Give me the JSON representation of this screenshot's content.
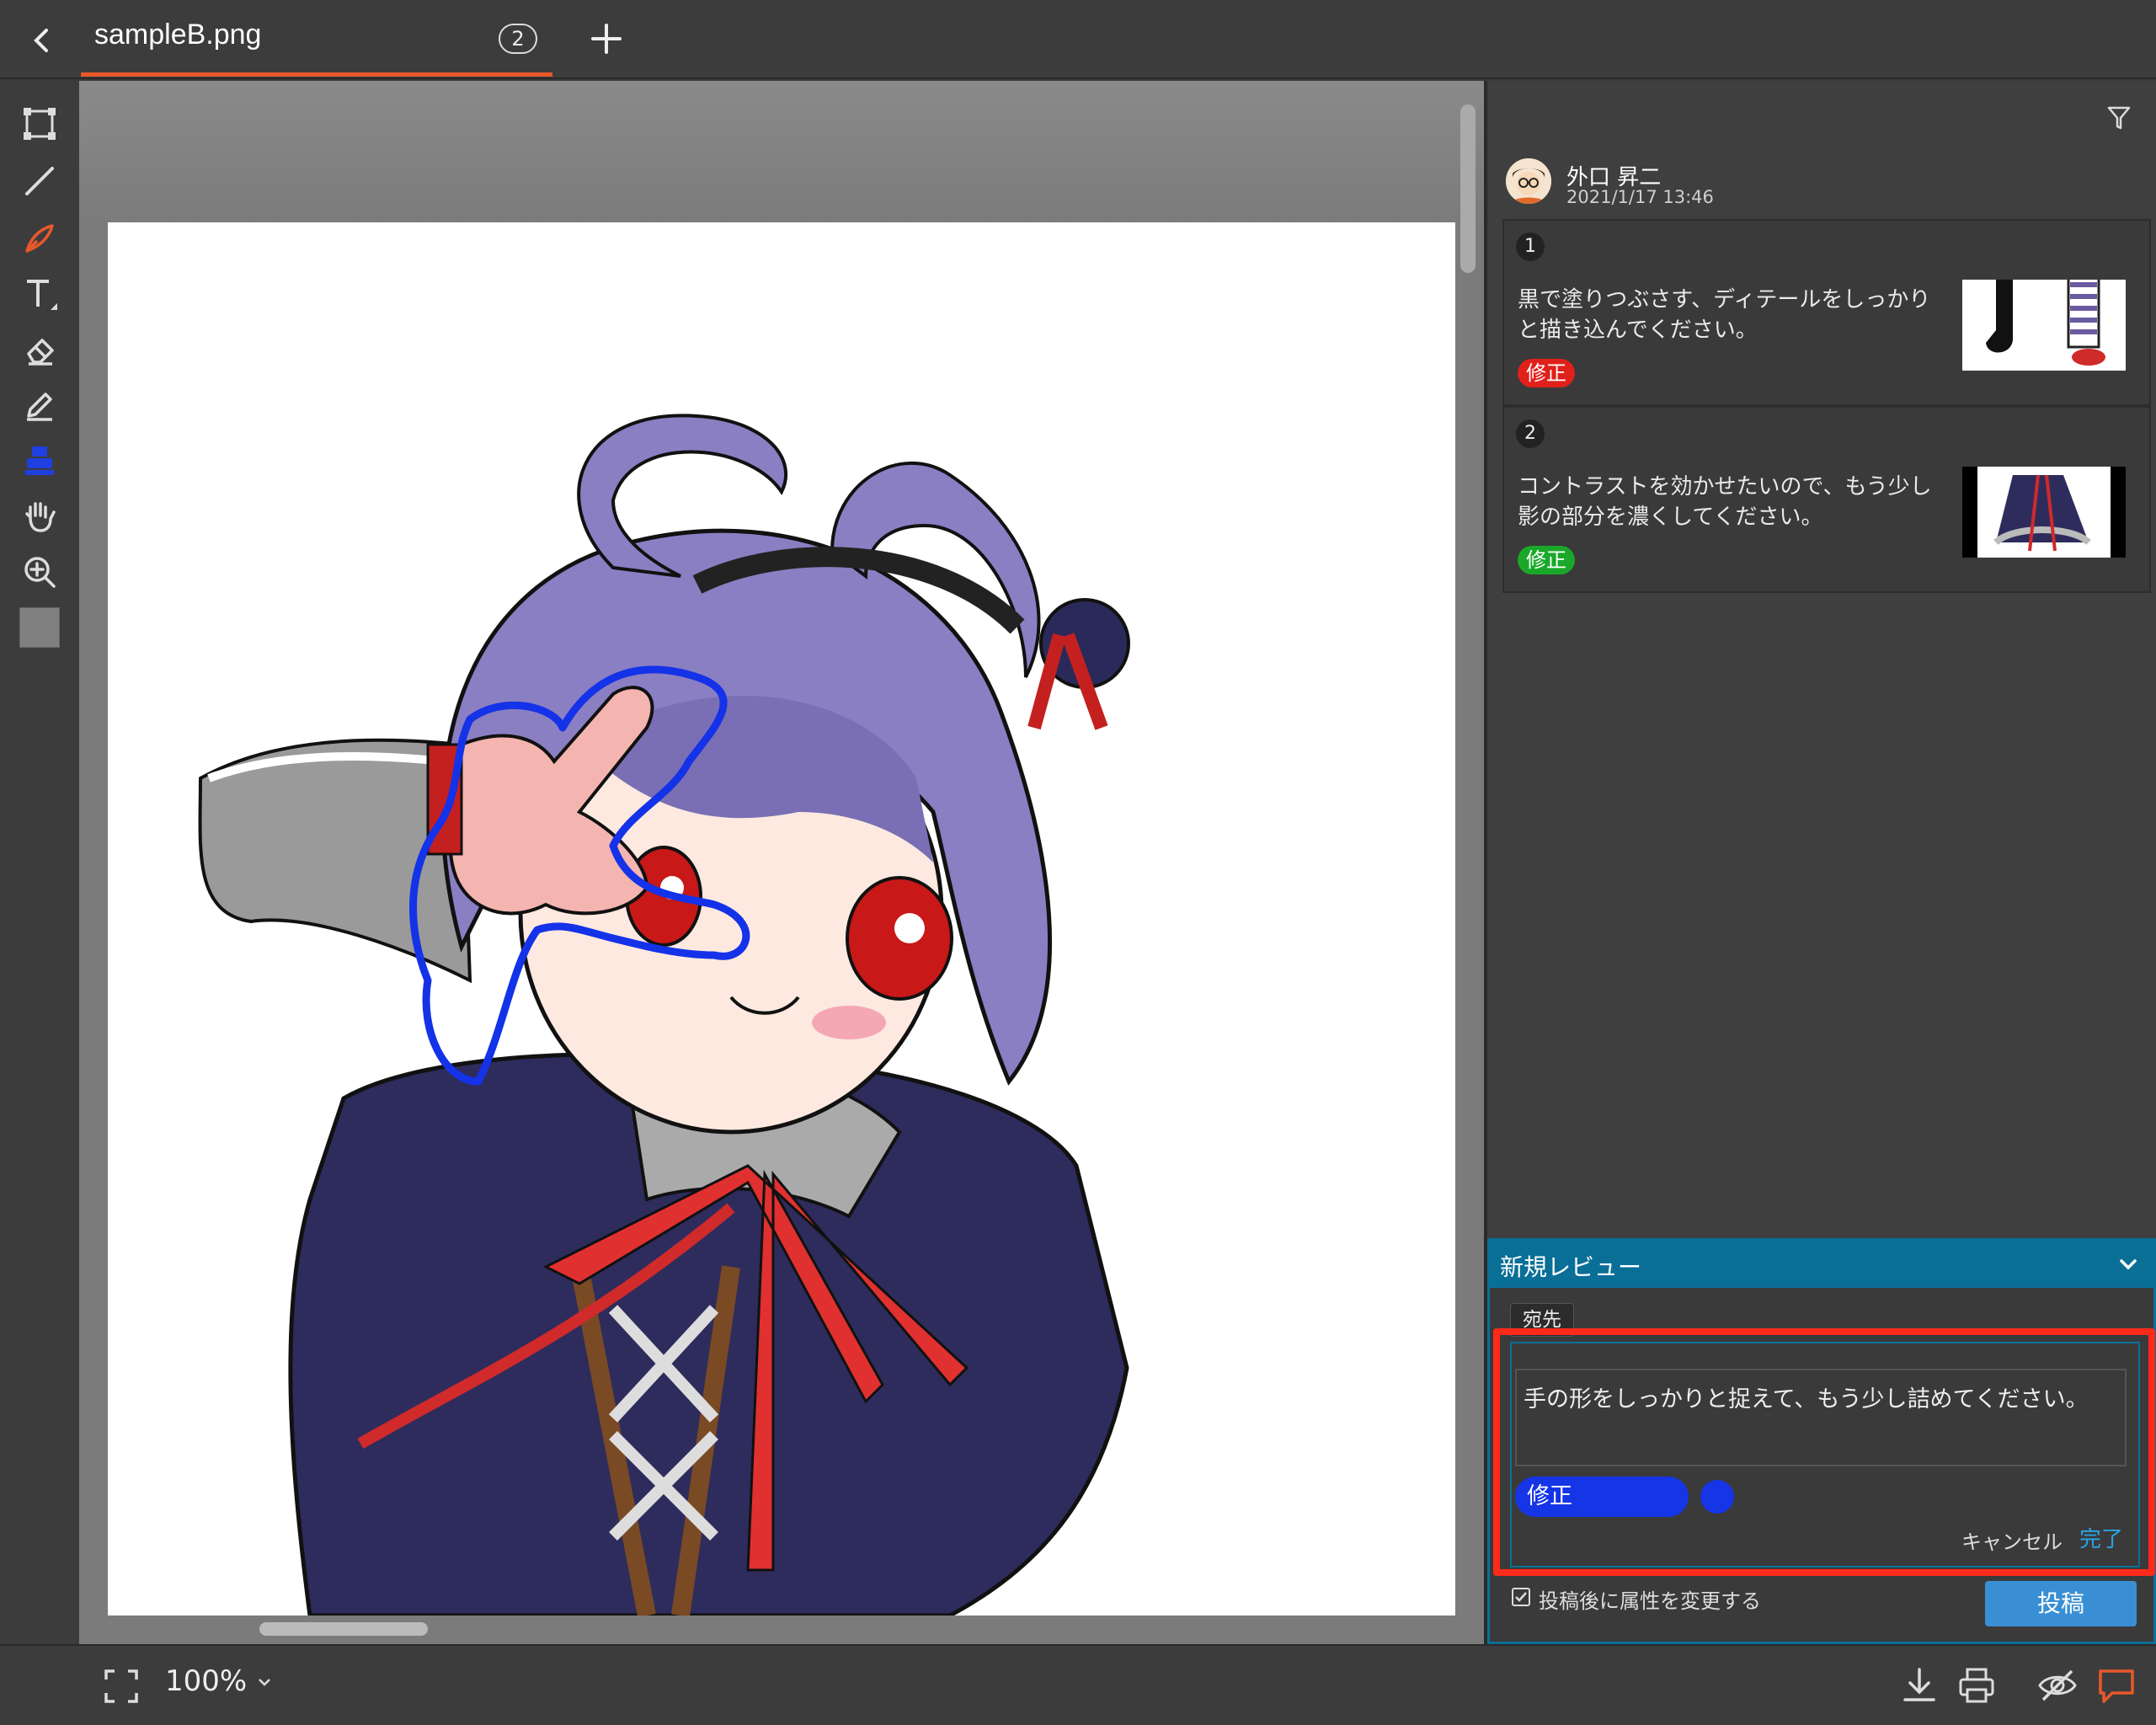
{
  "tab": {
    "title": "sampleB.png",
    "count": "2"
  },
  "icons": {
    "back": "chevron-left-icon",
    "add": "plus-icon",
    "tools": [
      "select-rect-icon",
      "line-icon",
      "pen-icon",
      "text-icon",
      "eraser-icon",
      "pencil-icon",
      "stamp-icon",
      "hand-icon",
      "zoom-in-icon",
      "color-swatch"
    ]
  },
  "colors": {
    "accent": "#e8582b",
    "panel_header": "#0a6f96",
    "status_blue": "#1535e6",
    "highlight": "#ff2a1a",
    "link": "#2aa3e6"
  },
  "review": {
    "reviewer": "外口 昇二",
    "date": "2021/1/17 13:46",
    "items": [
      {
        "num": "1",
        "text": "黒で塗りつぶさす、ディテールをしっかりと描き込んでください。",
        "status": "修正",
        "status_color": "#e0201a"
      },
      {
        "num": "2",
        "text": "コントラストを効かせたいので、もう少し影の部分を濃くしてください。",
        "status": "修正",
        "status_color": "#1aa82a"
      }
    ]
  },
  "new_review": {
    "title": "新規レビュー",
    "to_label": "宛先",
    "comment": "手の形をしっかりと捉えて、もう少し詰めてください。",
    "status": "修正",
    "cancel": "キャンセル",
    "done": "完了",
    "checkbox_label": "投稿後に属性を変更する",
    "post": "投稿"
  },
  "bottom": {
    "zoom": "100%"
  }
}
